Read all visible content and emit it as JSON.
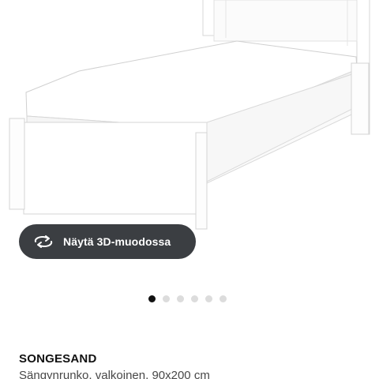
{
  "viewer": {
    "button_label": "Näytä 3D-muodossa",
    "button_icon": "rotate-3d-icon",
    "image_count": 6,
    "active_index": 0
  },
  "product": {
    "name": "SONGESAND",
    "description": "Sängynrunko, valkoinen, 90x200 cm"
  },
  "colors": {
    "button_bg": "#3b3e42",
    "dot_active": "#111111",
    "dot_inactive": "#dcdcdc"
  }
}
